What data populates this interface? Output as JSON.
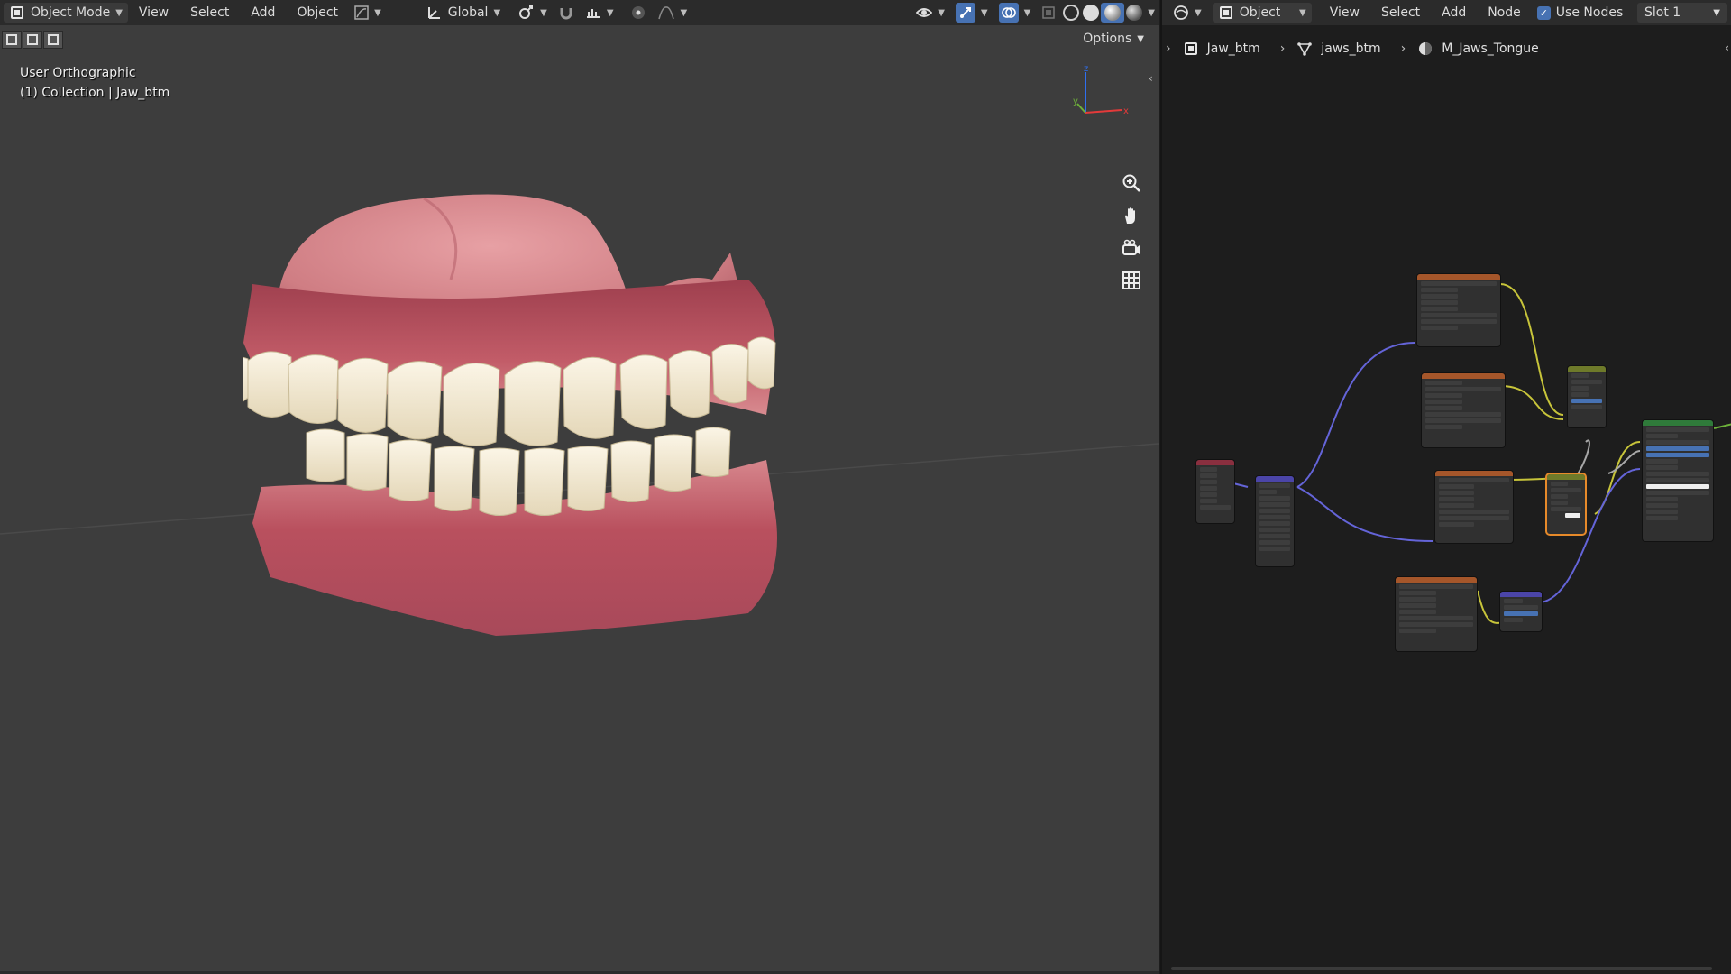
{
  "viewport": {
    "header": {
      "mode_label": "Object Mode",
      "menus": [
        "View",
        "Select",
        "Add",
        "Object"
      ],
      "orientation_label": "Global"
    },
    "options_label": "Options",
    "view_name": "User Orthographic",
    "collection_info": "(1) Collection | Jaw_btm",
    "gizmo_axes": {
      "x": "x",
      "y": "y",
      "z": "z"
    },
    "nav_icons": [
      "zoom-icon",
      "hand-pan-icon",
      "camera-icon",
      "grid-icon"
    ]
  },
  "node_editor": {
    "header": {
      "context_label": "Object",
      "menus": [
        "View",
        "Select",
        "Add",
        "Node"
      ],
      "use_nodes_label": "Use Nodes",
      "use_nodes_checked": true,
      "slot_label": "Slot 1"
    },
    "breadcrumb": {
      "object": "Jaw_btm",
      "mesh": "jaws_btm",
      "material": "M_Jaws_Tongue"
    }
  },
  "colors": {
    "accent": "#4772b3",
    "viewport_bg": "#3d3d3d",
    "node_bg": "#1d1d1d",
    "header_bg": "#2b2b2b",
    "wire_yellow": "#c7c43a",
    "wire_purple": "#6464d8",
    "wire_grey": "#a8a8a8",
    "gums": "#b04d5c",
    "teeth": "#eee5d0"
  }
}
